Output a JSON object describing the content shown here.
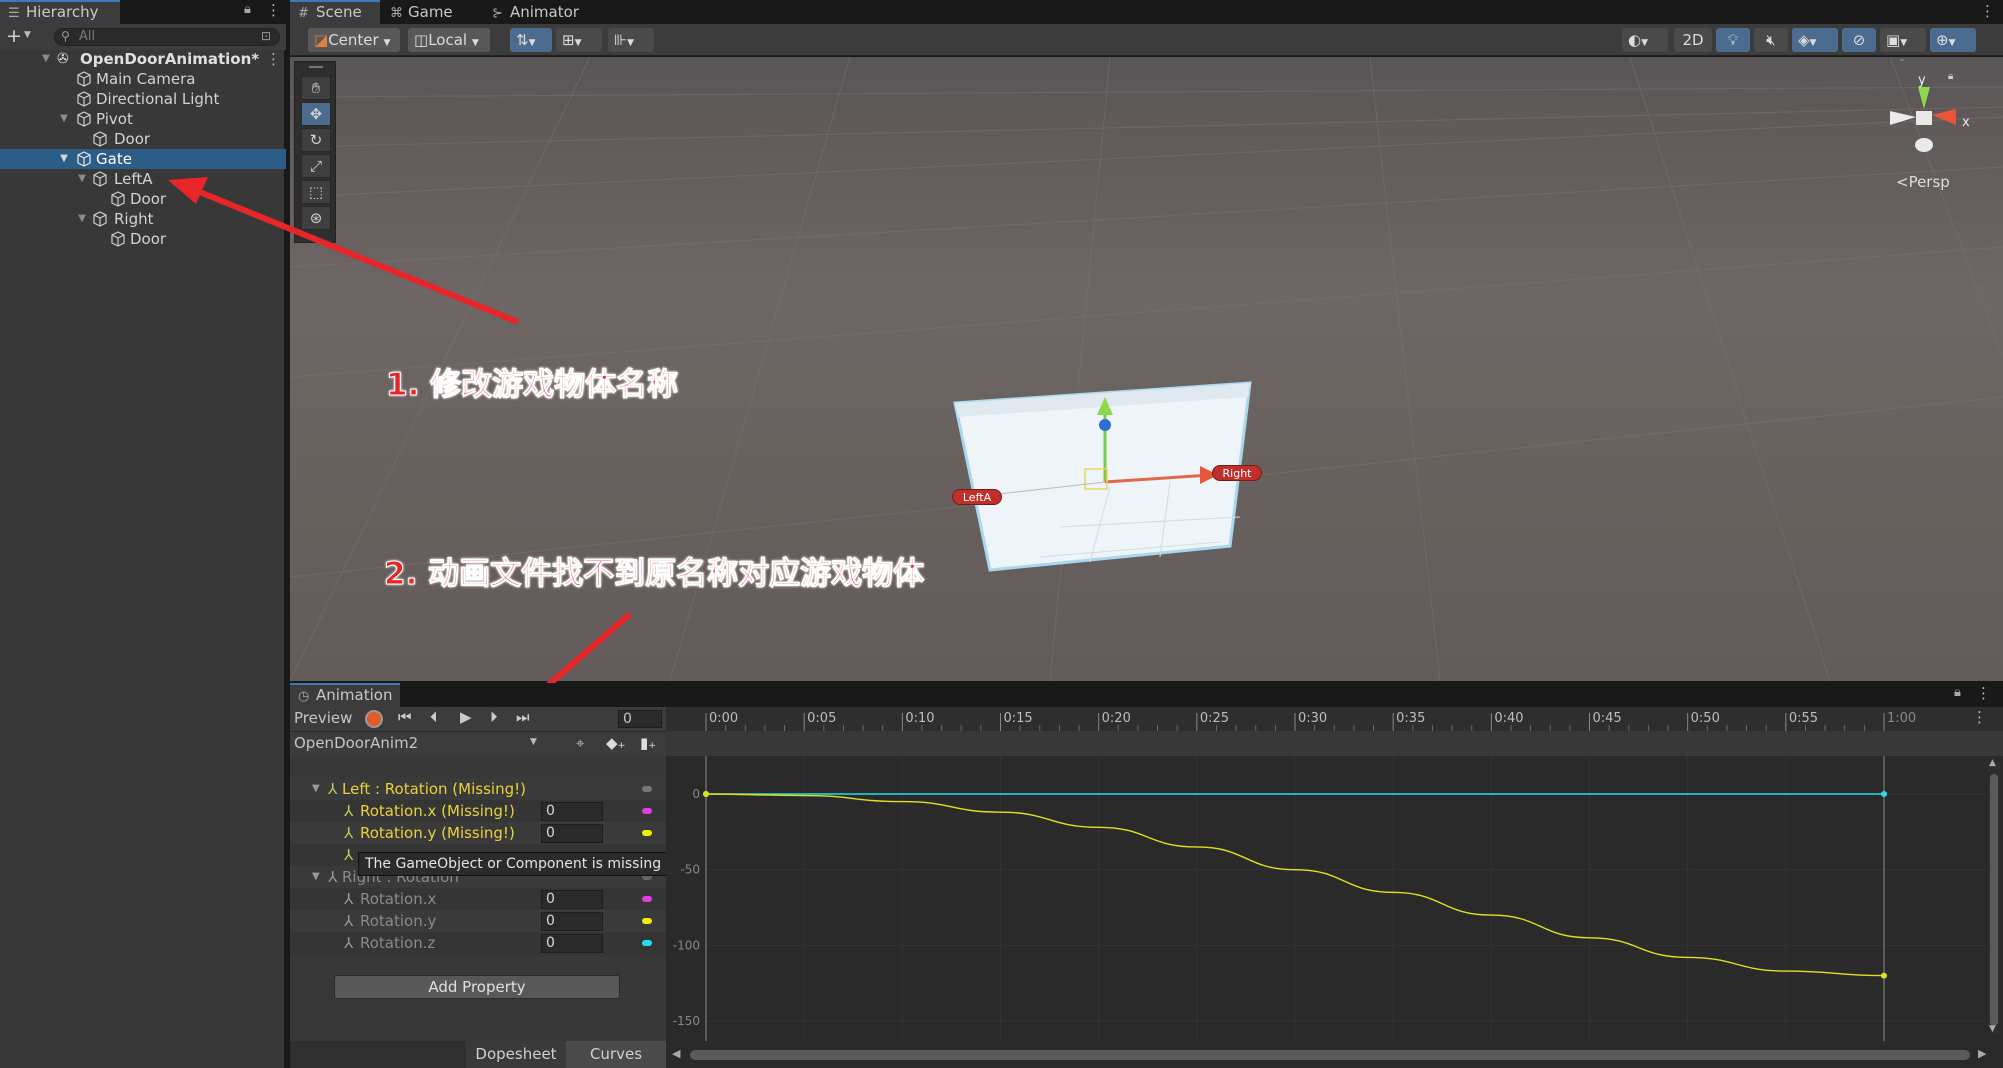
{
  "hierarchy": {
    "tab_label": "Hierarchy",
    "search_placeholder": "All",
    "scene_name": "OpenDoorAnimation*",
    "items": [
      {
        "label": "Main Camera",
        "depth": 1
      },
      {
        "label": "Directional Light",
        "depth": 1
      },
      {
        "label": "Pivot",
        "depth": 1
      },
      {
        "label": "Door",
        "depth": 2
      },
      {
        "label": "Gate",
        "depth": 1,
        "selected": true
      },
      {
        "label": "LeftA",
        "depth": 2
      },
      {
        "label": "Door",
        "depth": 3
      },
      {
        "label": "Right",
        "depth": 2
      },
      {
        "label": "Door",
        "depth": 3
      }
    ]
  },
  "scene_tabs": {
    "scene": "Scene",
    "game": "Game",
    "animator": "Animator"
  },
  "scene_toolbar": {
    "pivot": "Center",
    "space": "Local",
    "mode_2d": "2D"
  },
  "gizmo": {
    "y_label": "y",
    "x_label": "x",
    "projection": "<Persp"
  },
  "viewport_labels": {
    "left": "LeftA",
    "right": "Right"
  },
  "annotations": {
    "step1": "1. 修改游戏物体名称",
    "step2": "2. 动画文件找不到原名称对应游戏物体"
  },
  "animation": {
    "tab_label": "Animation",
    "preview_label": "Preview",
    "frame": "0",
    "clip_name": "OpenDoorAnim2",
    "properties": [
      {
        "label": "Left : Rotation (Missing!)",
        "group": true,
        "missing": true
      },
      {
        "label": "Rotation.x (Missing!)",
        "value": "0",
        "missing": true,
        "dot": "#e040e0"
      },
      {
        "label": "Rotation.y (Missing!)",
        "value": "0",
        "missing": true,
        "dot": "#f0f000"
      },
      {
        "label": "Right : Rotation",
        "group": true
      },
      {
        "label": "Rotation.x",
        "value": "0",
        "dot": "#e040e0"
      },
      {
        "label": "Rotation.y",
        "value": "0",
        "dot": "#f0f000"
      },
      {
        "label": "Rotation.z",
        "value": "0",
        "dot": "#20e0f0"
      }
    ],
    "tooltip": "The GameObject or Component is missing (Left)",
    "add_property": "Add Property",
    "tabs": {
      "dopesheet": "Dopesheet",
      "curves": "Curves"
    },
    "timeline_ticks": [
      "0:00",
      "0:05",
      "0:10",
      "0:15",
      "0:20",
      "0:25",
      "0:30",
      "0:35",
      "0:40",
      "0:45",
      "0:50",
      "0:55",
      "1:00"
    ],
    "value_ticks": [
      "0",
      "-50",
      "-100",
      "-150"
    ]
  },
  "chart_data": {
    "type": "line",
    "xlabel": "",
    "ylabel": "",
    "x_ticks": [
      "0:00",
      "0:05",
      "0:10",
      "0:15",
      "0:20",
      "0:25",
      "0:30",
      "0:35",
      "0:40",
      "0:45",
      "0:50",
      "0:55",
      "1:00"
    ],
    "ylim": [
      -150,
      0
    ],
    "series": [
      {
        "color": "#20e0f0",
        "x": [
          0,
          60
        ],
        "y": [
          0,
          0
        ]
      },
      {
        "color": "#e0e020",
        "x": [
          0,
          5,
          10,
          15,
          20,
          25,
          30,
          35,
          40,
          45,
          50,
          55,
          60
        ],
        "y": [
          0,
          -1,
          -5,
          -12,
          -22,
          -35,
          -50,
          -65,
          -80,
          -95,
          -108,
          -117,
          -120
        ]
      }
    ]
  }
}
